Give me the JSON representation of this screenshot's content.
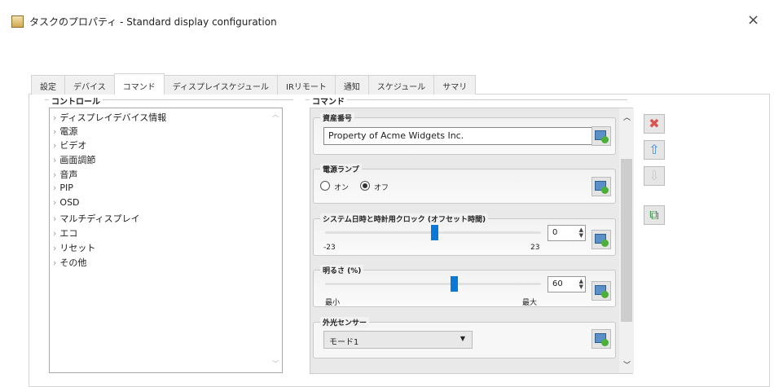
{
  "window": {
    "title": "タスクのプロパティ - Standard display configuration",
    "close": "×"
  },
  "tabs": [
    "設定",
    "デバイス",
    "コマンド",
    "ディスプレイスケジュール",
    "IRリモート",
    "通知",
    "スケジュール",
    "サマリ"
  ],
  "active_tab": "コマンド",
  "controls": {
    "label": "コントロール",
    "items": [
      "ディスプレイデバイス情報",
      "電源",
      "ビデオ",
      "画面調節",
      "音声",
      "PIP",
      "OSD",
      "マルチディスプレイ",
      "エコ",
      "リセット",
      "その他"
    ]
  },
  "commands": {
    "label": "コマンド",
    "asset": {
      "title": "資産番号",
      "value": "Property of Acme Widgets Inc."
    },
    "power_lamp": {
      "title": "電源ランプ",
      "on": "オン",
      "off": "オフ",
      "selected": "オフ"
    },
    "clock": {
      "title": "システム日時と時計用クロック (オフセット時間)",
      "min": "-23",
      "max": "23",
      "value": "0",
      "fraction": 0.5
    },
    "brightness": {
      "title": "明るさ (%)",
      "min": "最小",
      "max": "最大",
      "value": "60",
      "fraction": 0.6
    },
    "ambient": {
      "title": "外光センサー",
      "selected": "モード1"
    }
  },
  "colors": {
    "accent": "#0a78d7",
    "delete": "#d9534f"
  }
}
